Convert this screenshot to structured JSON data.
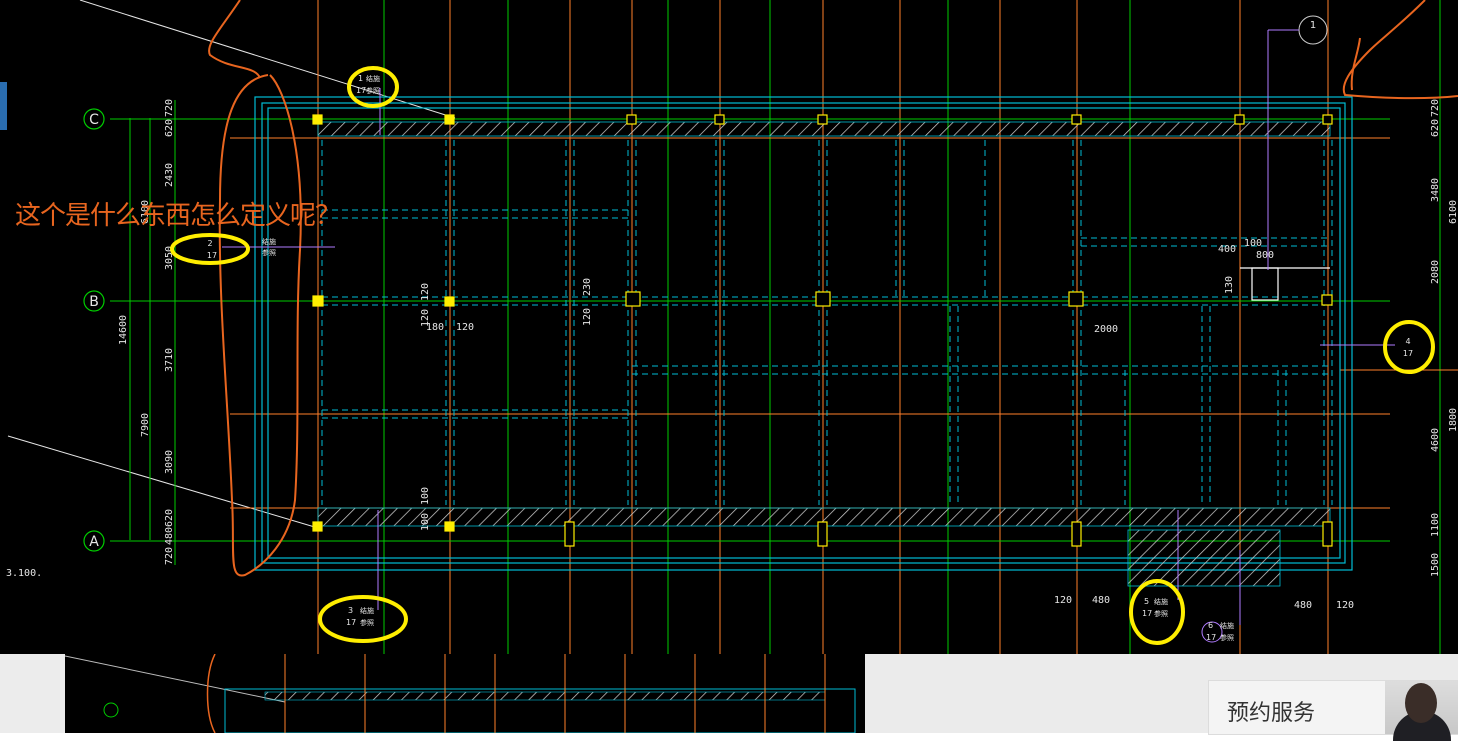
{
  "question": "这个是什么东西怎么定义呢？",
  "elevation_label": "3.100.",
  "service_label": "预约服务",
  "grid_axes": {
    "top": "C",
    "middle": "B",
    "bottom": "A"
  },
  "axis_marker_right": "1",
  "dimensions": {
    "left_outer": "14600",
    "left_mid": "7900",
    "left_segments": [
      "720",
      "620",
      "2430",
      "3050",
      "3710",
      "3090",
      "620",
      "480",
      "720"
    ],
    "left_small": "6100",
    "right_segments": [
      "720",
      "620",
      "3480",
      "2080",
      "4600",
      "1100",
      "1500"
    ],
    "right_small_a": "6100",
    "right_small_b": "1800",
    "beam_a": "120",
    "beam_b": "120",
    "beam_c": "180",
    "beam_d": "120",
    "beam_e": "230",
    "beam_f": "120",
    "beam_g": "100",
    "beam_h": "100",
    "opening_a": "400",
    "opening_b": "100",
    "opening_c": "800",
    "opening_d": "130",
    "span_a": "2000",
    "bottom_a": "120",
    "bottom_b": "480",
    "bottom_c": "480",
    "bottom_d": "120"
  },
  "section_marks": [
    {
      "num": "1",
      "sheet": "17",
      "note1": "结施",
      "note2": "参照"
    },
    {
      "num": "2",
      "sheet": "17",
      "note1": "结施",
      "note2": "参照"
    },
    {
      "num": "3",
      "sheet": "17",
      "note1": "结施",
      "note2": "参照"
    },
    {
      "num": "4",
      "sheet": "17"
    },
    {
      "num": "5",
      "sheet": "17",
      "note1": "结施",
      "note2": "参照"
    },
    {
      "num": "6",
      "sheet": "17",
      "note1": "结施",
      "note2": "参照"
    }
  ],
  "colors": {
    "background": "#000000",
    "grid_line": "#ff7f2a",
    "green_line": "#00cc00",
    "cyan_line": "#00bcd4",
    "highlight": "#ffee00",
    "annotation": "#e8651f",
    "service_accent": "#333333"
  }
}
